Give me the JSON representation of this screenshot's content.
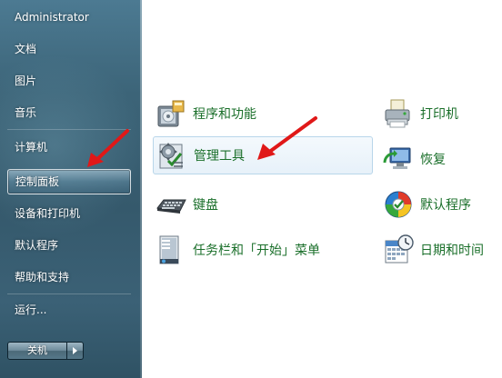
{
  "start_menu": {
    "items": [
      {
        "label": "Administrator"
      },
      {
        "label": "文档"
      },
      {
        "label": "图片"
      },
      {
        "label": "音乐"
      },
      {
        "label": "计算机"
      },
      {
        "label": "控制面板"
      },
      {
        "label": "设备和打印机"
      },
      {
        "label": "默认程序"
      },
      {
        "label": "帮助和支持"
      },
      {
        "label": "运行..."
      }
    ],
    "shutdown_label": "关机"
  },
  "control_panel": {
    "items": [
      {
        "label": "程序和功能",
        "icon": "programs-features-icon"
      },
      {
        "label": "打印机",
        "icon": "printer-icon"
      },
      {
        "label": "管理工具",
        "icon": "admin-tools-icon"
      },
      {
        "label": "恢复",
        "icon": "recovery-icon"
      },
      {
        "label": "键盘",
        "icon": "keyboard-icon"
      },
      {
        "label": "默认程序",
        "icon": "default-programs-icon"
      },
      {
        "label": "任务栏和「开始」菜单",
        "icon": "taskbar-icon"
      },
      {
        "label": "日期和时间",
        "icon": "date-time-icon"
      }
    ]
  },
  "colors": {
    "link_green": "#1a6f2a",
    "annotation_red": "#e01818",
    "menu_bg": "#3c6478"
  }
}
